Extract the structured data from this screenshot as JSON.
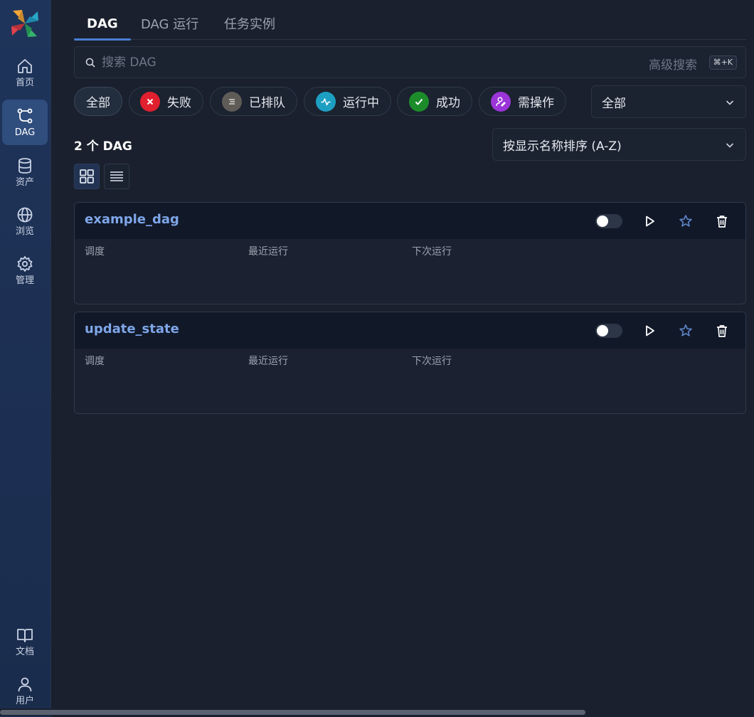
{
  "sidebar": {
    "items": [
      {
        "label": "首页",
        "icon": "home-icon"
      },
      {
        "label": "DAG",
        "icon": "dag-icon",
        "active": true
      },
      {
        "label": "资产",
        "icon": "database-icon"
      },
      {
        "label": "浏览",
        "icon": "globe-icon"
      },
      {
        "label": "管理",
        "icon": "gear-icon"
      }
    ],
    "bottom_items": [
      {
        "label": "文档",
        "icon": "book-icon"
      },
      {
        "label": "用户",
        "icon": "user-icon"
      }
    ]
  },
  "tabs": [
    {
      "label": "DAG",
      "active": true
    },
    {
      "label": "DAG 运行"
    },
    {
      "label": "任务实例"
    }
  ],
  "search": {
    "placeholder": "搜索 DAG",
    "value": "",
    "advanced_label": "高级搜索",
    "shortcut": "⌘+K"
  },
  "filters": [
    {
      "label": "全部",
      "active": true
    },
    {
      "label": "失败",
      "icon": "x-icon",
      "color": "#e0202e"
    },
    {
      "label": "已排队",
      "icon": "queue-icon",
      "color": "#5f5b57"
    },
    {
      "label": "运行中",
      "icon": "pulse-icon",
      "color": "#1d9fc2"
    },
    {
      "label": "成功",
      "icon": "check-icon",
      "color": "#1c8c2b"
    },
    {
      "label": "需操作",
      "icon": "user-edit-icon",
      "color": "#9b35d8"
    }
  ],
  "tag_filter": {
    "selected": "全部"
  },
  "summary": {
    "count_label": "2 个 DAG"
  },
  "sort": {
    "selected": "按显示名称排序 (A-Z)"
  },
  "view_toggle": {
    "card_icon": "grid-icon",
    "list_icon": "list-icon",
    "active": "card"
  },
  "dags": [
    {
      "name": "example_dag",
      "paused": true,
      "columns": [
        "调度",
        "最近运行",
        "下次运行"
      ]
    },
    {
      "name": "update_state",
      "paused": true,
      "columns": [
        "调度",
        "最近运行",
        "下次运行"
      ]
    }
  ],
  "colors": {
    "sidebar_bg": "#1f345a",
    "page_bg": "#1a202d",
    "accent": "#4a7fd6",
    "dag_link": "#7ea6e8"
  }
}
